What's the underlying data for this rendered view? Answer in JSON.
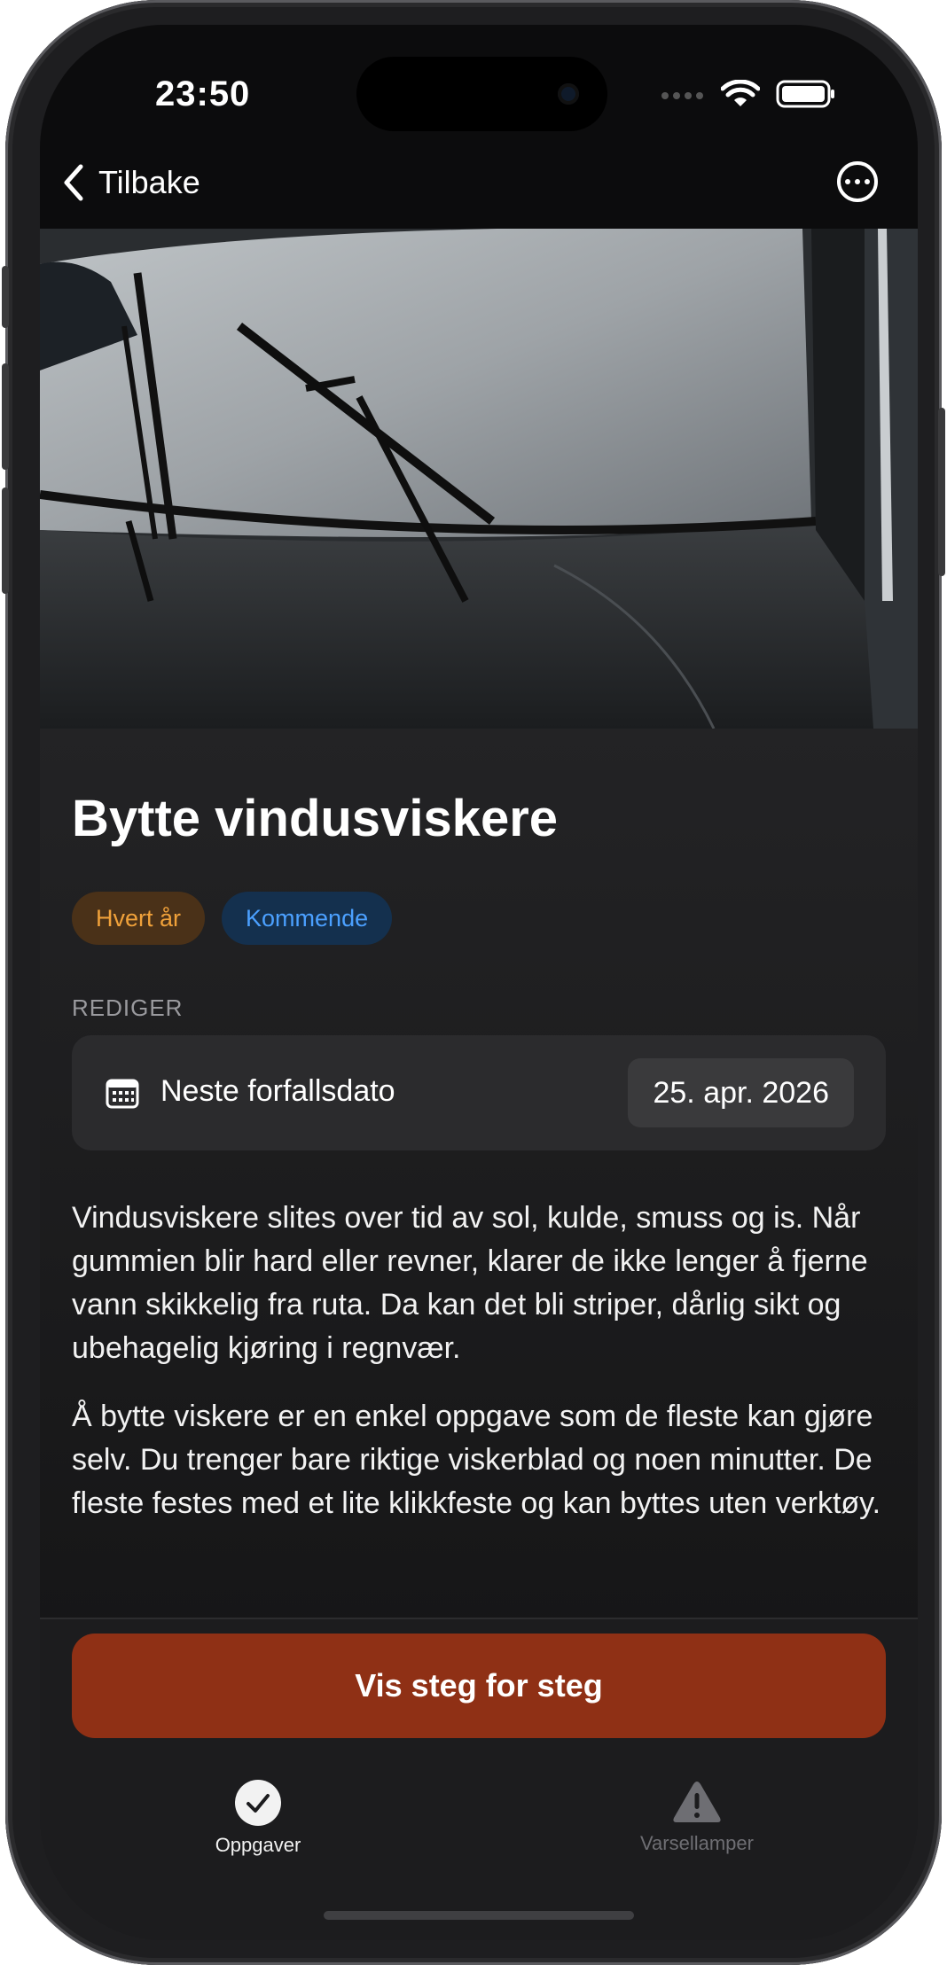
{
  "status": {
    "time": "23:50"
  },
  "nav": {
    "back_label": "Tilbake"
  },
  "hero": {
    "icon": "car-windshield-wipers-image"
  },
  "task": {
    "title": "Bytte vindusviskere",
    "chips": {
      "frequency": "Hvert år",
      "state": "Kommende"
    },
    "section_label": "REDIGER",
    "due": {
      "label": "Neste forfallsdato",
      "value": "25. apr. 2026"
    },
    "description": [
      "Vindusviskere slites over tid av sol, kulde, smuss og is. Når gummien blir hard eller revner, klarer de ikke lenger å fjerne vann skikkelig fra ruta. Da kan det bli striper, dårlig sikt og ubehagelig kjøring i regnvær.",
      "Å bytte viskere er en enkel oppgave som de fleste kan gjøre selv. Du trenger bare riktige viskerblad og noen minutter. De fleste festes med et lite klikkfeste og kan byttes uten verktøy."
    ],
    "cta_label": "Vis steg for steg"
  },
  "tabs": [
    {
      "label": "Oppgaver",
      "icon": "checkmark-circle-icon",
      "active": true
    },
    {
      "label": "Varsellamper",
      "icon": "warning-triangle-icon",
      "active": false
    }
  ],
  "colors": {
    "accent": "#8F3015",
    "chip_yearly": "#F0A13A",
    "chip_upcoming": "#4BA0FF",
    "background": "#1C1C1E"
  }
}
